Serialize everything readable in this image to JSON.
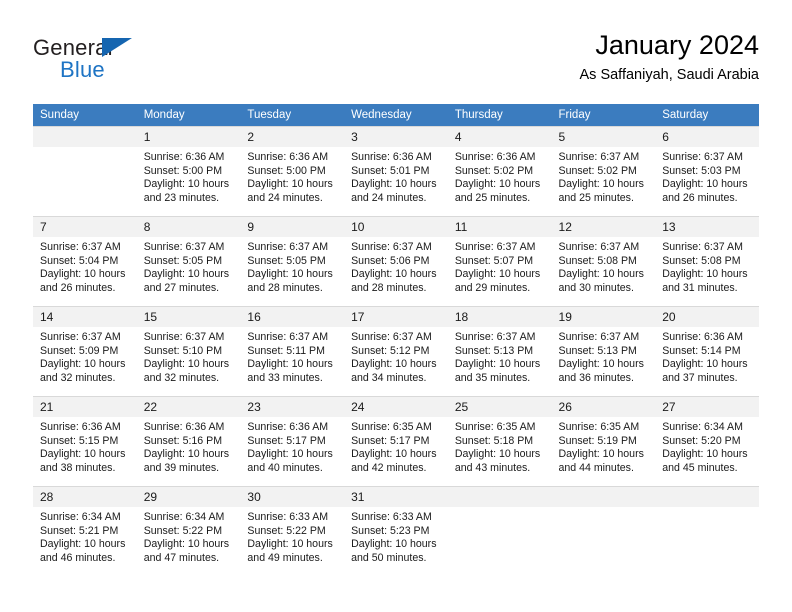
{
  "brand": {
    "line1": "General",
    "line2": "Blue",
    "triangle_color": "#1565b0",
    "blue_text_color": "#1e74c4"
  },
  "header": {
    "title": "January 2024",
    "subtitle": "As Saffaniyah, Saudi Arabia"
  },
  "theme": {
    "header_row_bg": "#3b7cbf",
    "header_row_text": "#ffffff",
    "daynum_band_bg": "#f2f2f2",
    "grid_line": "#d9d9d9"
  },
  "weekdays": [
    "Sunday",
    "Monday",
    "Tuesday",
    "Wednesday",
    "Thursday",
    "Friday",
    "Saturday"
  ],
  "weeks": [
    [
      {
        "day": "",
        "blank": true,
        "sunrise": "",
        "sunset": "",
        "daylight_line1": "",
        "daylight_line2": ""
      },
      {
        "day": "1",
        "sunrise": "Sunrise: 6:36 AM",
        "sunset": "Sunset: 5:00 PM",
        "daylight_line1": "Daylight: 10 hours",
        "daylight_line2": "and 23 minutes."
      },
      {
        "day": "2",
        "sunrise": "Sunrise: 6:36 AM",
        "sunset": "Sunset: 5:00 PM",
        "daylight_line1": "Daylight: 10 hours",
        "daylight_line2": "and 24 minutes."
      },
      {
        "day": "3",
        "sunrise": "Sunrise: 6:36 AM",
        "sunset": "Sunset: 5:01 PM",
        "daylight_line1": "Daylight: 10 hours",
        "daylight_line2": "and 24 minutes."
      },
      {
        "day": "4",
        "sunrise": "Sunrise: 6:36 AM",
        "sunset": "Sunset: 5:02 PM",
        "daylight_line1": "Daylight: 10 hours",
        "daylight_line2": "and 25 minutes."
      },
      {
        "day": "5",
        "sunrise": "Sunrise: 6:37 AM",
        "sunset": "Sunset: 5:02 PM",
        "daylight_line1": "Daylight: 10 hours",
        "daylight_line2": "and 25 minutes."
      },
      {
        "day": "6",
        "sunrise": "Sunrise: 6:37 AM",
        "sunset": "Sunset: 5:03 PM",
        "daylight_line1": "Daylight: 10 hours",
        "daylight_line2": "and 26 minutes."
      }
    ],
    [
      {
        "day": "7",
        "sunrise": "Sunrise: 6:37 AM",
        "sunset": "Sunset: 5:04 PM",
        "daylight_line1": "Daylight: 10 hours",
        "daylight_line2": "and 26 minutes."
      },
      {
        "day": "8",
        "sunrise": "Sunrise: 6:37 AM",
        "sunset": "Sunset: 5:05 PM",
        "daylight_line1": "Daylight: 10 hours",
        "daylight_line2": "and 27 minutes."
      },
      {
        "day": "9",
        "sunrise": "Sunrise: 6:37 AM",
        "sunset": "Sunset: 5:05 PM",
        "daylight_line1": "Daylight: 10 hours",
        "daylight_line2": "and 28 minutes."
      },
      {
        "day": "10",
        "sunrise": "Sunrise: 6:37 AM",
        "sunset": "Sunset: 5:06 PM",
        "daylight_line1": "Daylight: 10 hours",
        "daylight_line2": "and 28 minutes."
      },
      {
        "day": "11",
        "sunrise": "Sunrise: 6:37 AM",
        "sunset": "Sunset: 5:07 PM",
        "daylight_line1": "Daylight: 10 hours",
        "daylight_line2": "and 29 minutes."
      },
      {
        "day": "12",
        "sunrise": "Sunrise: 6:37 AM",
        "sunset": "Sunset: 5:08 PM",
        "daylight_line1": "Daylight: 10 hours",
        "daylight_line2": "and 30 minutes."
      },
      {
        "day": "13",
        "sunrise": "Sunrise: 6:37 AM",
        "sunset": "Sunset: 5:08 PM",
        "daylight_line1": "Daylight: 10 hours",
        "daylight_line2": "and 31 minutes."
      }
    ],
    [
      {
        "day": "14",
        "sunrise": "Sunrise: 6:37 AM",
        "sunset": "Sunset: 5:09 PM",
        "daylight_line1": "Daylight: 10 hours",
        "daylight_line2": "and 32 minutes."
      },
      {
        "day": "15",
        "sunrise": "Sunrise: 6:37 AM",
        "sunset": "Sunset: 5:10 PM",
        "daylight_line1": "Daylight: 10 hours",
        "daylight_line2": "and 32 minutes."
      },
      {
        "day": "16",
        "sunrise": "Sunrise: 6:37 AM",
        "sunset": "Sunset: 5:11 PM",
        "daylight_line1": "Daylight: 10 hours",
        "daylight_line2": "and 33 minutes."
      },
      {
        "day": "17",
        "sunrise": "Sunrise: 6:37 AM",
        "sunset": "Sunset: 5:12 PM",
        "daylight_line1": "Daylight: 10 hours",
        "daylight_line2": "and 34 minutes."
      },
      {
        "day": "18",
        "sunrise": "Sunrise: 6:37 AM",
        "sunset": "Sunset: 5:13 PM",
        "daylight_line1": "Daylight: 10 hours",
        "daylight_line2": "and 35 minutes."
      },
      {
        "day": "19",
        "sunrise": "Sunrise: 6:37 AM",
        "sunset": "Sunset: 5:13 PM",
        "daylight_line1": "Daylight: 10 hours",
        "daylight_line2": "and 36 minutes."
      },
      {
        "day": "20",
        "sunrise": "Sunrise: 6:36 AM",
        "sunset": "Sunset: 5:14 PM",
        "daylight_line1": "Daylight: 10 hours",
        "daylight_line2": "and 37 minutes."
      }
    ],
    [
      {
        "day": "21",
        "sunrise": "Sunrise: 6:36 AM",
        "sunset": "Sunset: 5:15 PM",
        "daylight_line1": "Daylight: 10 hours",
        "daylight_line2": "and 38 minutes."
      },
      {
        "day": "22",
        "sunrise": "Sunrise: 6:36 AM",
        "sunset": "Sunset: 5:16 PM",
        "daylight_line1": "Daylight: 10 hours",
        "daylight_line2": "and 39 minutes."
      },
      {
        "day": "23",
        "sunrise": "Sunrise: 6:36 AM",
        "sunset": "Sunset: 5:17 PM",
        "daylight_line1": "Daylight: 10 hours",
        "daylight_line2": "and 40 minutes."
      },
      {
        "day": "24",
        "sunrise": "Sunrise: 6:35 AM",
        "sunset": "Sunset: 5:17 PM",
        "daylight_line1": "Daylight: 10 hours",
        "daylight_line2": "and 42 minutes."
      },
      {
        "day": "25",
        "sunrise": "Sunrise: 6:35 AM",
        "sunset": "Sunset: 5:18 PM",
        "daylight_line1": "Daylight: 10 hours",
        "daylight_line2": "and 43 minutes."
      },
      {
        "day": "26",
        "sunrise": "Sunrise: 6:35 AM",
        "sunset": "Sunset: 5:19 PM",
        "daylight_line1": "Daylight: 10 hours",
        "daylight_line2": "and 44 minutes."
      },
      {
        "day": "27",
        "sunrise": "Sunrise: 6:34 AM",
        "sunset": "Sunset: 5:20 PM",
        "daylight_line1": "Daylight: 10 hours",
        "daylight_line2": "and 45 minutes."
      }
    ],
    [
      {
        "day": "28",
        "sunrise": "Sunrise: 6:34 AM",
        "sunset": "Sunset: 5:21 PM",
        "daylight_line1": "Daylight: 10 hours",
        "daylight_line2": "and 46 minutes."
      },
      {
        "day": "29",
        "sunrise": "Sunrise: 6:34 AM",
        "sunset": "Sunset: 5:22 PM",
        "daylight_line1": "Daylight: 10 hours",
        "daylight_line2": "and 47 minutes."
      },
      {
        "day": "30",
        "sunrise": "Sunrise: 6:33 AM",
        "sunset": "Sunset: 5:22 PM",
        "daylight_line1": "Daylight: 10 hours",
        "daylight_line2": "and 49 minutes."
      },
      {
        "day": "31",
        "sunrise": "Sunrise: 6:33 AM",
        "sunset": "Sunset: 5:23 PM",
        "daylight_line1": "Daylight: 10 hours",
        "daylight_line2": "and 50 minutes."
      },
      {
        "day": "",
        "blank": true,
        "sunrise": "",
        "sunset": "",
        "daylight_line1": "",
        "daylight_line2": ""
      },
      {
        "day": "",
        "blank": true,
        "sunrise": "",
        "sunset": "",
        "daylight_line1": "",
        "daylight_line2": ""
      },
      {
        "day": "",
        "blank": true,
        "sunrise": "",
        "sunset": "",
        "daylight_line1": "",
        "daylight_line2": ""
      }
    ]
  ]
}
